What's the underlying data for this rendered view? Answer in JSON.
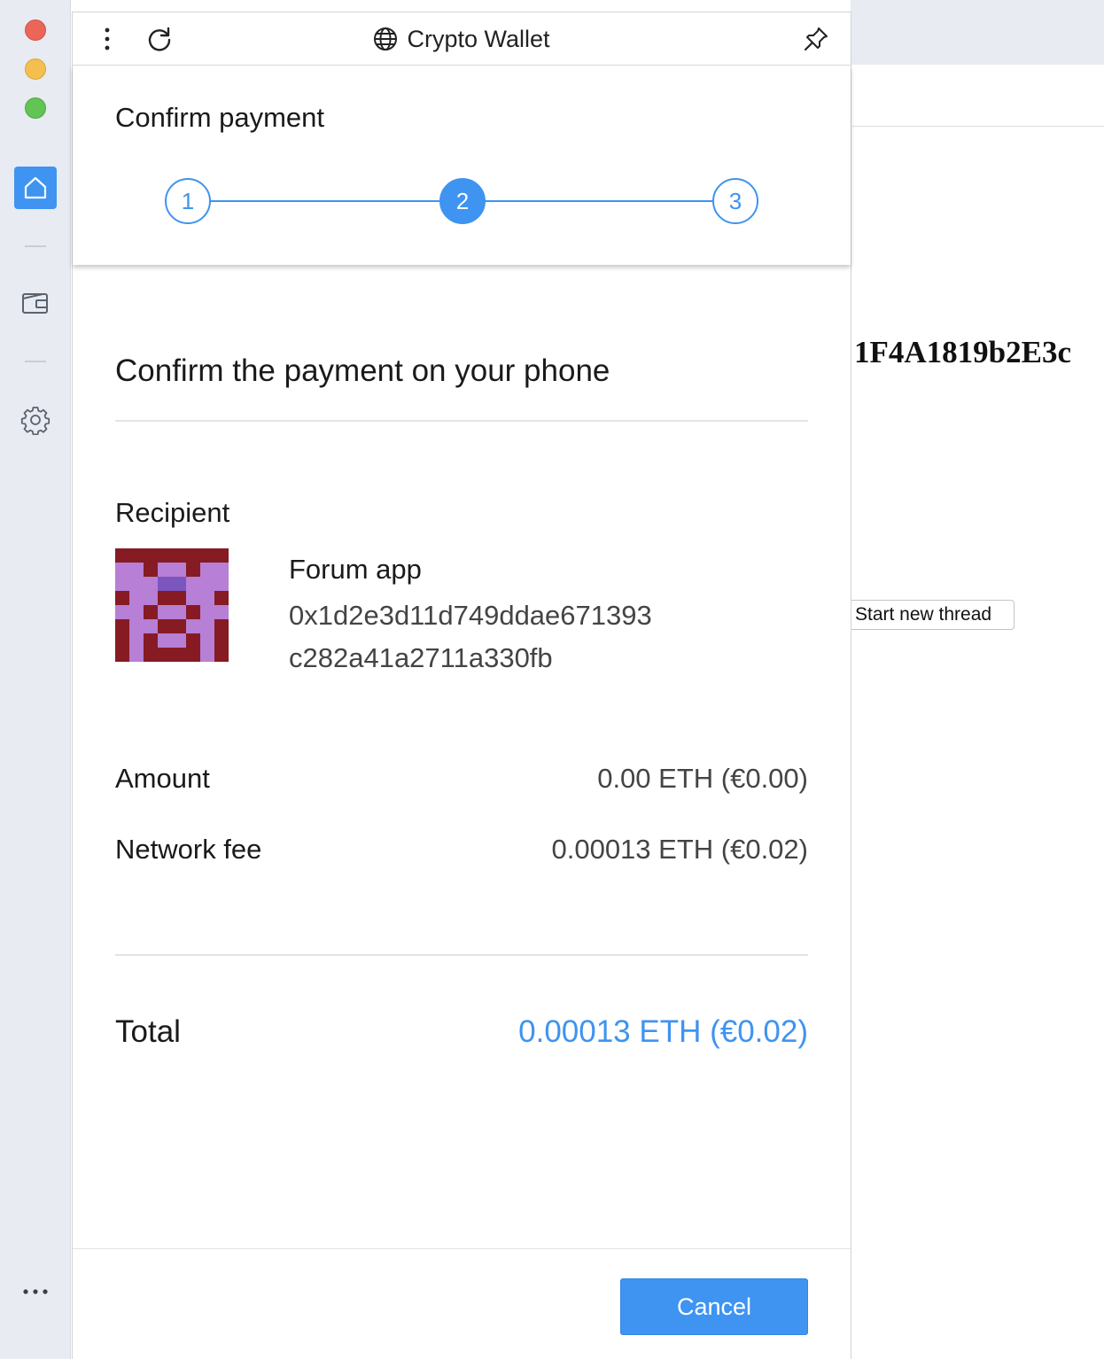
{
  "window": {
    "title": "Crypto Wallet"
  },
  "sidebar": {
    "items": [
      {
        "icon": "home-icon",
        "active": true
      },
      {
        "icon": "wallet-icon",
        "active": false
      },
      {
        "icon": "gear-icon",
        "active": false
      },
      {
        "icon": "more-icon",
        "active": false
      }
    ]
  },
  "background_page": {
    "address_fragment": "1F4A1819b2E3c",
    "start_thread_label": "Start new thread"
  },
  "header": {
    "title": "Confirm payment",
    "steps": [
      "1",
      "2",
      "3"
    ],
    "active_step": 2
  },
  "main": {
    "heading": "Confirm the payment on your phone",
    "recipient_label": "Recipient",
    "recipient_name": "Forum app",
    "recipient_address": "0x1d2e3d11d749ddae671393c282a41a2711a330fb",
    "amount_label": "Amount",
    "amount_value": "0.00 ETH (€0.00)",
    "fee_label": "Network fee",
    "fee_value": "0.00013 ETH (€0.02)",
    "total_label": "Total",
    "total_value": "0.00013 ETH (€0.02)"
  },
  "footer": {
    "cancel_label": "Cancel"
  },
  "colors": {
    "accent": "#3e94f0",
    "rail_bg": "#e8ebf1",
    "avatar_dark": "#861b24",
    "avatar_light": "#b77fd6",
    "avatar_purple": "#7b56bf"
  }
}
